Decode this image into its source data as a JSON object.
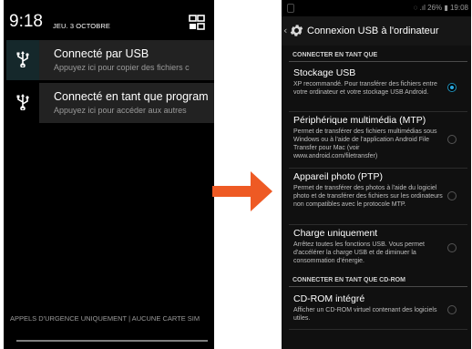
{
  "left_phone": {
    "time": "9:18",
    "date": "JEU. 3 OCTOBRE",
    "notifications": [
      {
        "title": "Connecté par USB",
        "subtitle": "Appuyez ici pour copier des fichiers c",
        "icon": "usb-icon"
      },
      {
        "title": "Connecté en tant que program",
        "subtitle": "Appuyez ici pour accéder aux autres",
        "icon": "usb-icon"
      }
    ],
    "emergency_text": "APPELS D'URGENCE UNIQUEMENT | AUCUNE CARTE SIM"
  },
  "right_phone": {
    "status": {
      "battery": "26%",
      "time": "19:08"
    },
    "title": "Connexion USB à l'ordinateur",
    "section1": "CONNECTER EN TANT QUE",
    "section2": "CONNECTER EN TANT QUE CD-ROM",
    "options": [
      {
        "title": "Stockage USB",
        "desc": "XP recommandé. Pour transférer des fichiers entre votre ordinateur et votre stockage USB Android.",
        "selected": true
      },
      {
        "title": "Périphérique multimédia (MTP)",
        "desc": "Permet de transférer des fichiers multimédias sous Windows ou à l'aide de l'application Android File Transfer pour Mac (voir www.android.com/filetransfer)",
        "selected": false
      },
      {
        "title": "Appareil photo (PTP)",
        "desc": "Permet de transférer des photos à l'aide du logiciel photo et de transférer des fichiers sur les ordinateurs non compatibles avec le protocole MTP.",
        "selected": false
      },
      {
        "title": "Charge uniquement",
        "desc": "Arrêtez toutes les fonctions USB. Vous permet d'accélérer la charge USB et de diminuer la consommation d'énergie.",
        "selected": false
      }
    ],
    "cdrom_option": {
      "title": "CD-ROM intégré",
      "desc": "Afficher un CD-ROM virtuel contenant des logiciels utiles.",
      "selected": false
    }
  },
  "colors": {
    "accent": "#2aa8e0",
    "arrow": "#ee5a24"
  }
}
